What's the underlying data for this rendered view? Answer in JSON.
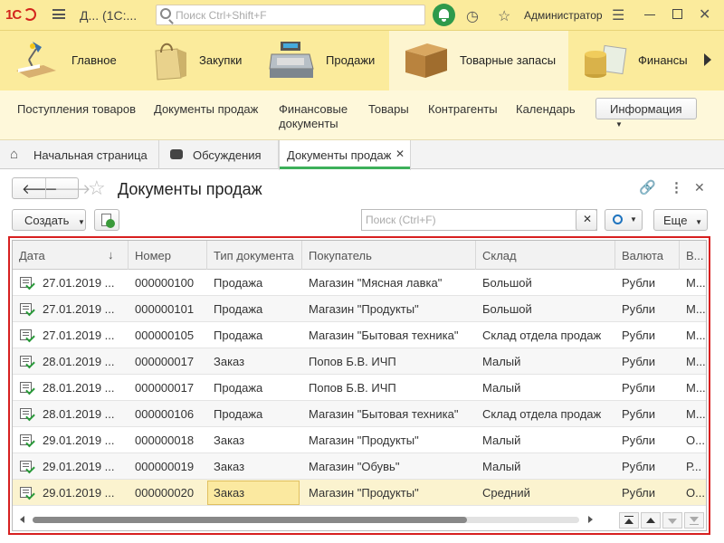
{
  "app": {
    "logo": "1С",
    "title": "Д...  (1С:...",
    "search_placeholder": "Поиск Ctrl+Shift+F",
    "user": "Администратор"
  },
  "sections": [
    {
      "label": "Главное",
      "icon": "desk-lamp-icon"
    },
    {
      "label": "Закупки",
      "icon": "shopping-bag-icon"
    },
    {
      "label": "Продажи",
      "icon": "cash-register-icon"
    },
    {
      "label": "Товарные запасы",
      "icon": "box-icon",
      "active": true
    },
    {
      "label": "Финансы",
      "icon": "coins-icon"
    }
  ],
  "subnav": {
    "items": [
      "Поступления товаров",
      "Документы продаж",
      "Финансовые документы",
      "Товары",
      "Контрагенты",
      "Календарь"
    ],
    "info_button": "Информация"
  },
  "tabs": [
    {
      "label": "Начальная страница"
    },
    {
      "label": "Обсуждения"
    },
    {
      "label": "Документы продаж",
      "active": true
    }
  ],
  "page": {
    "title": "Документы продаж",
    "create_button": "Создать",
    "search_placeholder": "Поиск (Ctrl+F)",
    "more_button": "Еще"
  },
  "table": {
    "columns": [
      "Дата",
      "Номер",
      "Тип документа",
      "Покупатель",
      "Склад",
      "Валюта",
      "В..."
    ],
    "rows": [
      [
        "27.01.2019 ...",
        "000000100",
        "Продажа",
        "Магазин \"Мясная лавка\"",
        "Большой",
        "Рубли",
        "М..."
      ],
      [
        "27.01.2019 ...",
        "000000101",
        "Продажа",
        "Магазин \"Продукты\"",
        "Большой",
        "Рубли",
        "М..."
      ],
      [
        "27.01.2019 ...",
        "000000105",
        "Продажа",
        "Магазин \"Бытовая техника\"",
        "Склад отдела продаж",
        "Рубли",
        "М..."
      ],
      [
        "28.01.2019 ...",
        "000000017",
        "Заказ",
        "Попов Б.В. ИЧП",
        "Малый",
        "Рубли",
        "М..."
      ],
      [
        "28.01.2019 ...",
        "000000017",
        "Продажа",
        "Попов Б.В. ИЧП",
        "Малый",
        "Рубли",
        "М..."
      ],
      [
        "28.01.2019 ...",
        "000000106",
        "Продажа",
        "Магазин \"Бытовая техника\"",
        "Склад отдела продаж",
        "Рубли",
        "М..."
      ],
      [
        "29.01.2019 ...",
        "000000018",
        "Заказ",
        "Магазин \"Продукты\"",
        "Малый",
        "Рубли",
        "О..."
      ],
      [
        "29.01.2019 ...",
        "000000019",
        "Заказ",
        "Магазин \"Обувь\"",
        "Малый",
        "Рубли",
        "Р..."
      ],
      [
        "29.01.2019 ...",
        "000000020",
        "Заказ",
        "Магазин \"Продукты\"",
        "Средний",
        "Рубли",
        "О..."
      ]
    ],
    "sort_indicator": "↓"
  },
  "colors": {
    "titlebar": "#fbeb9c",
    "accent_red": "#d72020",
    "selected_row": "#fbf3cf"
  }
}
